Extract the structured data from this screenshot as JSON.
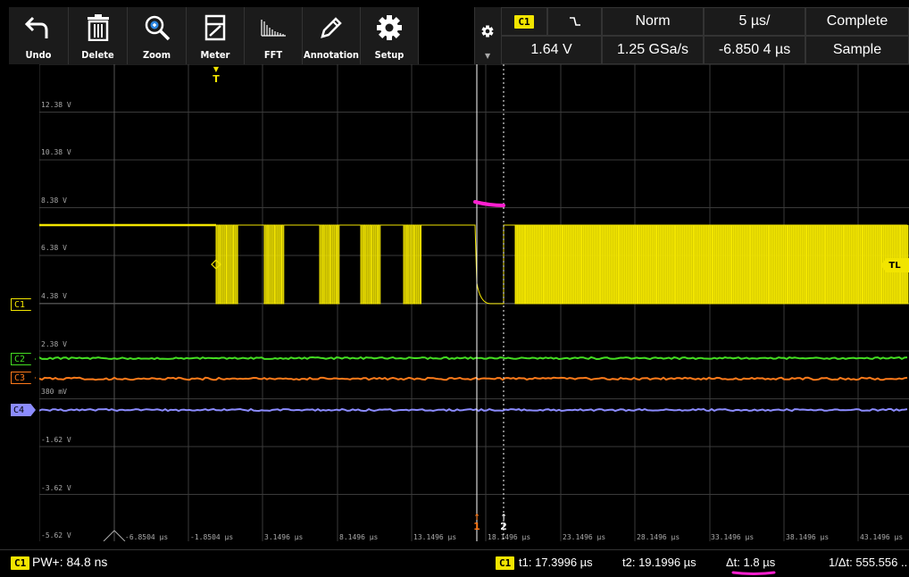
{
  "toolbar": {
    "buttons": [
      {
        "label": "Undo",
        "icon": "undo-icon"
      },
      {
        "label": "Delete",
        "icon": "trash-icon"
      },
      {
        "label": "Zoom",
        "icon": "zoom-icon"
      },
      {
        "label": "Meter",
        "icon": "meter-icon"
      },
      {
        "label": "FFT",
        "icon": "fft-icon"
      },
      {
        "label": "Annotation",
        "icon": "pencil-icon"
      },
      {
        "label": "Setup",
        "icon": "gear-icon"
      }
    ]
  },
  "trigger": {
    "channel": "C1",
    "slope_icon": "falling-edge-icon",
    "mode": "Norm",
    "level": "1.64 V",
    "timebase": "5 µs/",
    "sample_rate": "1.25 GSa/s",
    "acq_status": "Complete",
    "position": "-6.850 4 µs",
    "acq_mode": "Sample",
    "marker": "T"
  },
  "display": {
    "y_labels": [
      "12.38 V",
      "10.38 V",
      "8.38 V",
      "6.38 V",
      "4.38 V",
      "2.38 V",
      "380 mV",
      "-1.62 V",
      "-3.62 V",
      "-5.62 V"
    ],
    "x_labels": [
      "-6.8504 µs",
      "-1.8504 µs",
      "3.1496 µs",
      "8.1496 µs",
      "13.1496 µs",
      "18.1496 µs",
      "23.1496 µs",
      "28.1496 µs",
      "33.1496 µs",
      "38.1496 µs",
      "43.1496 µs"
    ],
    "channels": [
      {
        "label": "C1",
        "color": "#f2e500"
      },
      {
        "label": "C2",
        "color": "#44dd22"
      },
      {
        "label": "C3",
        "color": "#ff7a1a"
      },
      {
        "label": "C4",
        "color": "#8c8cff"
      }
    ],
    "trigger_level_tag": "TL",
    "cursor1": "1",
    "cursor2": "2"
  },
  "status": {
    "channel": "C1",
    "pw": "PW+: 84.8 ns",
    "t1": "t1: 17.3996 µs",
    "t2": "t2: 19.1996 µs",
    "dt": "Δt: 1.8 µs",
    "inv_dt": "1/Δt: 555.556 .."
  },
  "colors": {
    "c1": "#f2e500",
    "c2": "#44dd22",
    "c3": "#ff7a1a",
    "c4": "#8c8cff",
    "annotation": "#ff1fd0",
    "grid": "#3a3a3a"
  }
}
